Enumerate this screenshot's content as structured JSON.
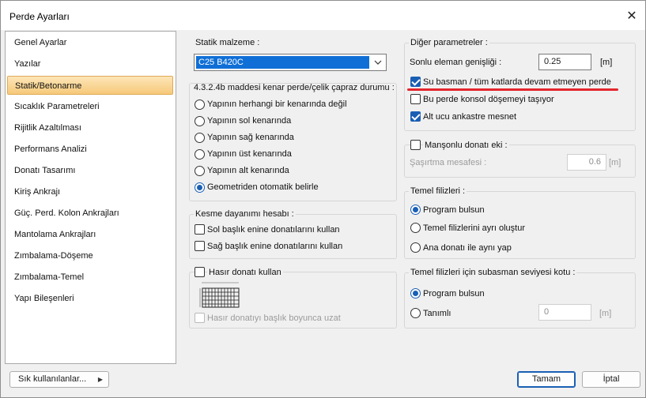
{
  "window": {
    "title": "Perde Ayarları"
  },
  "sidebar": {
    "items": [
      "Genel Ayarlar",
      "Yazılar",
      "Statik/Betonarme",
      "Sıcaklık Parametreleri",
      "Rijitlik Azaltılması",
      "Performans Analizi",
      "Donatı Tasarımı",
      "Kiriş Ankrajı",
      "Güç. Perd. Kolon Ankrajları",
      "Mantolama Ankrajları",
      "Zımbalama-Döşeme",
      "Zımbalama-Temel",
      "Yapı Bileşenleri"
    ],
    "active_index": 2
  },
  "statik": {
    "label": "Statik malzeme :",
    "selected": "C25 B420C"
  },
  "kenar": {
    "label": "4.3.2.4b maddesi kenar perde/çelik çapraz durumu :",
    "options": [
      "Yapının herhangi bir kenarında değil",
      "Yapının sol kenarında",
      "Yapının sağ kenarında",
      "Yapının üst kenarında",
      "Yapının alt kenarında",
      "Geometriden otomatik belirle"
    ],
    "selected_index": 5
  },
  "kesme": {
    "label": "Kesme dayanımı hesabı :",
    "sol": "Sol başlık enine donatılarını kullan",
    "sag": "Sağ başlık enine donatılarını kullan"
  },
  "hasir": {
    "label": "Hasır donatı kullan",
    "uzat": "Hasır donatıyı başlık boyunca uzat"
  },
  "diger": {
    "label": "Diğer parametreler :",
    "sonlu_label": "Sonlu eleman genişliği :",
    "sonlu_value": "0.25",
    "sonlu_unit": "[m]",
    "su_basman": "Su basman / tüm katlarda devam etmeyen perde",
    "konsol": "Bu perde konsol döşemeyi taşıyor",
    "alt_ucu": "Alt ucu ankastre mesnet"
  },
  "manson": {
    "label": "Manşonlu donatı eki :",
    "sasirtma_label": "Şaşırtma mesafesi :",
    "sasirtma_value": "0.6",
    "unit": "[m]"
  },
  "temel": {
    "label": "Temel filizleri :",
    "options": [
      "Program bulsun",
      "Temel filizlerini ayrı oluştur",
      "Ana donatı ile aynı yap"
    ],
    "selected_index": 0
  },
  "subasman": {
    "label": "Temel filizleri için subasman seviyesi kotu :",
    "options": [
      "Program bulsun",
      "Tanımlı"
    ],
    "selected_index": 0,
    "value": "0",
    "unit": "[m]"
  },
  "footer": {
    "frequent": "Sık kullanılanlar...",
    "ok": "Tamam",
    "cancel": "İptal"
  },
  "colors": {
    "accent": "#1a5fb4",
    "annotation": "#e3262c",
    "selected": "#0f6fd6"
  }
}
